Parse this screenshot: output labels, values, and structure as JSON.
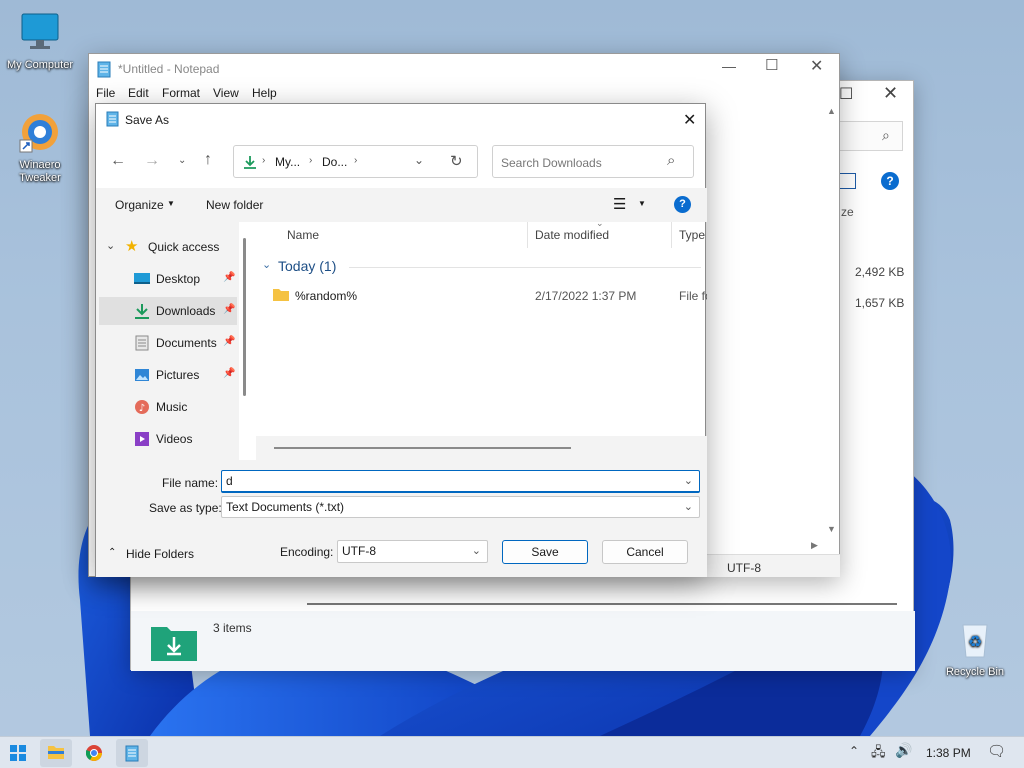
{
  "desktop": {
    "icons": [
      {
        "label": "My Computer"
      },
      {
        "label": "Winaero Tweaker"
      },
      {
        "label": "Recycle Bin"
      }
    ]
  },
  "explorer": {
    "col_size_partial": "ze",
    "sizes": [
      "2,492 KB",
      "1,657 KB"
    ],
    "status": "3 items"
  },
  "notepad": {
    "title": "*Untitled - Notepad",
    "menu": [
      "File",
      "Edit",
      "Format",
      "View",
      "Help"
    ],
    "encoding_status": "UTF-8"
  },
  "dialog": {
    "title": "Save As",
    "breadcrumb": [
      "My...",
      "Do..."
    ],
    "search_placeholder": "Search Downloads",
    "organize_label": "Organize",
    "new_folder_label": "New folder",
    "columns": [
      "Name",
      "Date modified",
      "Type"
    ],
    "group_label": "Today (1)",
    "files": [
      {
        "name": "%random%",
        "date": "2/17/2022 1:37 PM",
        "type": "File fo"
      }
    ],
    "nav": [
      {
        "label": "Quick access",
        "pinned": false
      },
      {
        "label": "Desktop",
        "pinned": true
      },
      {
        "label": "Downloads",
        "pinned": true,
        "selected": true
      },
      {
        "label": "Documents",
        "pinned": true
      },
      {
        "label": "Pictures",
        "pinned": true
      },
      {
        "label": "Music",
        "pinned": false
      },
      {
        "label": "Videos",
        "pinned": false
      }
    ],
    "file_name_label": "File name:",
    "file_name_value": "d",
    "save_type_label": "Save as type:",
    "save_type_value": "Text Documents (*.txt)",
    "hide_folders_label": "Hide Folders",
    "encoding_label": "Encoding:",
    "encoding_value": "UTF-8",
    "save_label": "Save",
    "cancel_label": "Cancel"
  },
  "taskbar": {
    "time": "1:38 PM"
  },
  "colors": {
    "accent": "#0067c0",
    "selected_nav": "#e5e5e5",
    "folder_yellow": "#f5c242",
    "download_green": "#1c9a5c"
  }
}
